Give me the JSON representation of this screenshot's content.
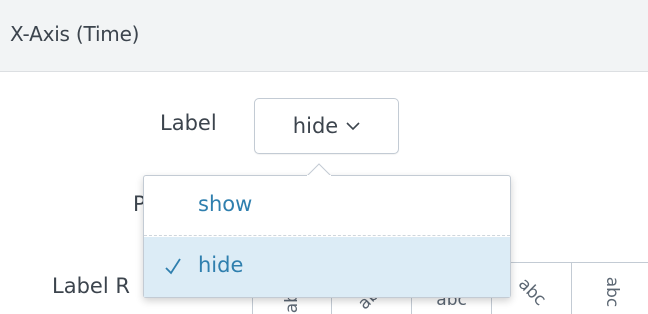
{
  "panel": {
    "title": "X-Axis (Time)"
  },
  "fields": {
    "label": {
      "name": "Label",
      "selected": "hide"
    },
    "partial": {
      "text": "P"
    },
    "rotation": {
      "name": "Label R",
      "options": [
        "abc",
        "abc",
        "abc",
        "abc",
        "abc"
      ]
    }
  },
  "dropdown": {
    "options": [
      {
        "label": "show",
        "selected": false
      },
      {
        "label": "hide",
        "selected": true
      }
    ]
  },
  "colors": {
    "accent": "#2f7fae",
    "selected_bg": "#dcecf6",
    "header_bg": "#f2f4f5",
    "border": "#c3cbd4"
  },
  "icons": {
    "select": "chevron-down-icon",
    "selected": "checkmark-icon"
  }
}
